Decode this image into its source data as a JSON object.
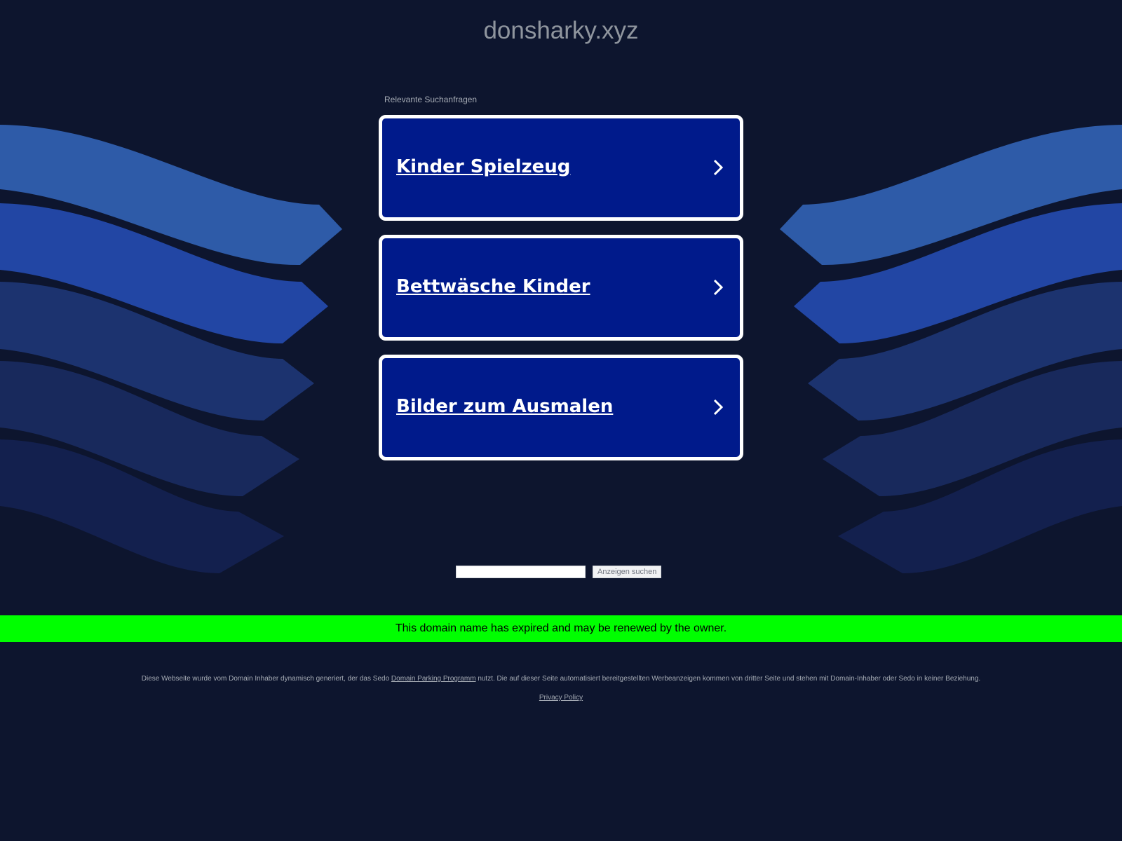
{
  "domain": "donsharky.xyz",
  "related_label": "Relevante Suchanfragen",
  "links": [
    {
      "label": "Kinder Spielzeug"
    },
    {
      "label": "Bettwäsche Kinder"
    },
    {
      "label": "Bilder zum Ausmalen"
    }
  ],
  "search": {
    "value": "",
    "button_label": "Anzeigen suchen"
  },
  "banner": {
    "text": "This domain name has expired and may be renewed by the owner.",
    "color": "#00ff00"
  },
  "footer": {
    "text_before": "Diese Webseite wurde vom Domain Inhaber dynamisch generiert, der das Sedo",
    "link_label": "Domain Parking Programm",
    "text_after": "nutzt. Die auf dieser Seite automatisiert bereitgestellten Werbeanzeigen kommen von dritter Seite und stehen mit Domain-Inhaber oder Sedo in keiner Beziehung.",
    "privacy_label": "Privacy Policy"
  },
  "colors": {
    "background": "#0d152e",
    "link_box": "#001a8b",
    "link_border": "#ffffff"
  }
}
